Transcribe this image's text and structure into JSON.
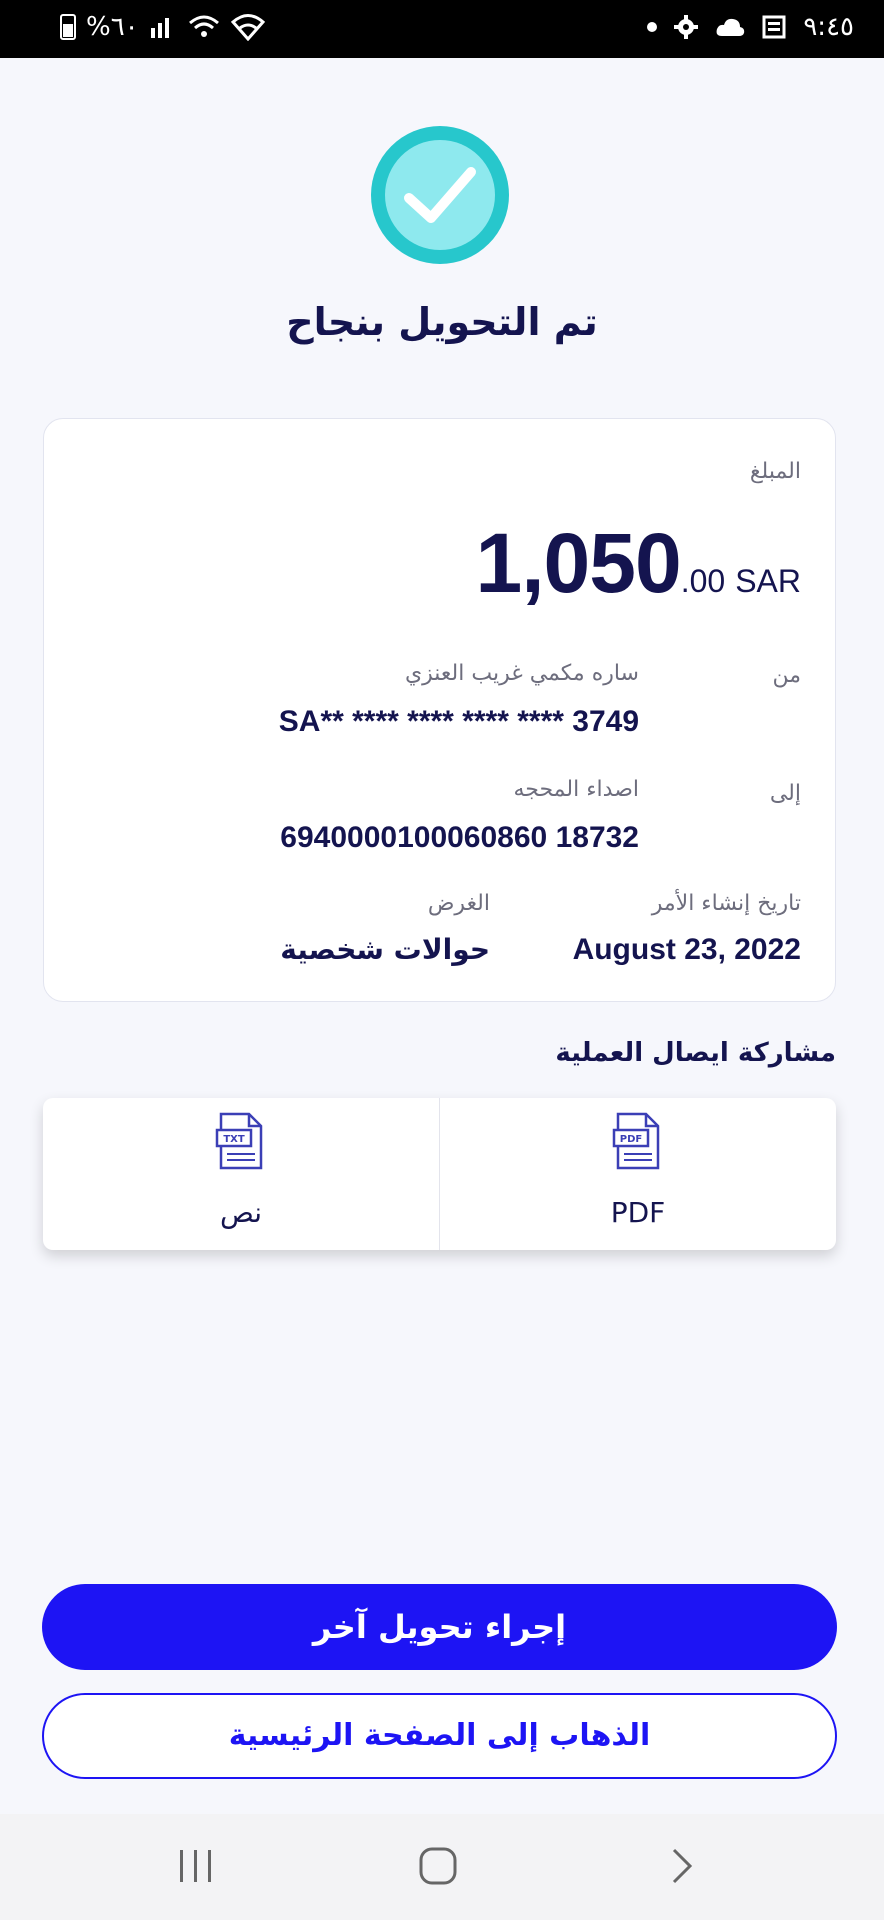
{
  "status_bar": {
    "battery_text": "%٦٠",
    "time": "٩:٤٥"
  },
  "colors": {
    "accent": "#1d14f4",
    "text_dark": "#14144f",
    "success_outer": "#27c7cc",
    "success_inner": "#8ee9ee"
  },
  "header": {
    "title": "تم التحويل بنجاح"
  },
  "details": {
    "amount_label": "المبلغ",
    "amount_main": "1,050",
    "amount_decimal": ".00",
    "currency": "SAR",
    "from_label": "من",
    "from_name": "ساره مكمي غريب العنزي",
    "from_iban": "SA** **** **** **** **** 3749",
    "to_label": "إلى",
    "to_name": "اصداء المحجه",
    "to_account": "6940000100060860 18732",
    "date_label": "تاريخ إنشاء الأمر",
    "date_value": "August 23, 2022",
    "purpose_label": "الغرض",
    "purpose_value": "حوالات شخصية"
  },
  "share": {
    "title": "مشاركة ايصال العملية",
    "options": [
      {
        "label": "PDF",
        "icon": "pdf-file-icon",
        "icon_text": "PDF"
      },
      {
        "label": "نص",
        "icon": "txt-file-icon",
        "icon_text": "TXT"
      }
    ]
  },
  "actions": {
    "primary_label": "إجراء تحويل آخر",
    "secondary_label": "الذهاب إلى الصفحة الرئيسية"
  },
  "nav": {
    "recent": "recent-apps-icon",
    "home": "home-icon",
    "back": "back-icon"
  }
}
